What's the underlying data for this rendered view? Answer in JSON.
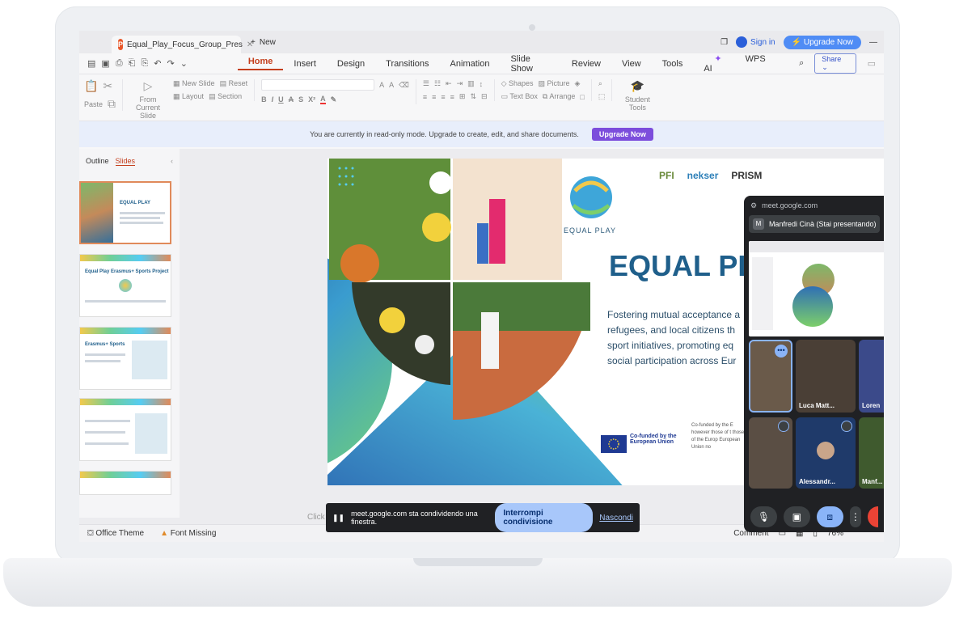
{
  "window": {
    "tab_title": "Equal_Play_Focus_Group_Pres",
    "new_tab": "New",
    "sign_in": "Sign in",
    "upgrade_now": "Upgrade Now"
  },
  "menu": {
    "items": [
      "Home",
      "Insert",
      "Design",
      "Transitions",
      "Animation",
      "Slide Show",
      "Review",
      "View",
      "Tools"
    ],
    "wps_ai": "WPS AI",
    "share": "Share"
  },
  "ribbon": {
    "paste": "Paste",
    "from_current_slide": "From Current Slide",
    "new_slide": "New Slide",
    "layout": "Layout",
    "reset": "Reset",
    "section": "Section",
    "shapes": "Shapes",
    "picture": "Picture",
    "text_box": "Text Box",
    "arrange": "Arrange",
    "student_tools": "Student Tools"
  },
  "banner": {
    "text": "You are currently in read-only mode. Upgrade to create, edit, and share documents.",
    "button": "Upgrade Now"
  },
  "left_panel": {
    "tab_outline": "Outline",
    "tab_slides": "Slides",
    "thumb1_title": "EQUAL PLAY",
    "thumb2_title": "Equal Play Erasmus+ Sports Project",
    "thumb3_title": "Erasmus+ Sports"
  },
  "slide": {
    "logo_caption": "EQUAL PLAY",
    "title": "EQUAL PL",
    "body": "Fostering mutual acceptance a refugees, and local citizens th sport initiatives, promoting eq social participation across Eur",
    "eu_label": "Co-funded by the European Union",
    "eu_disclaimer": "Co-funded by the E however those of t those of the Europ European Union no",
    "partner_logos": [
      "PFI",
      "nekser",
      "PRISM"
    ]
  },
  "notes_placeholder": "Click to add notes",
  "status": {
    "theme": "Office Theme",
    "font_missing": "Font Missing",
    "comment": "Comment",
    "zoom": "76%"
  },
  "sharebar": {
    "message": "meet.google.com sta condividendo una finestra.",
    "stop": "Interrompi condivisione",
    "hide": "Nascondi"
  },
  "meet": {
    "url": "meet.google.com",
    "presenter_badge": "M",
    "presenter": "Manfredi Cinà (Stai presentando)",
    "participants": [
      "Luca Matt...",
      "Loren",
      "Alessandr...",
      "Manf..."
    ]
  },
  "colors": {
    "accent": "#c43e1c",
    "banner_button": "#7c4ddc",
    "upgrade": "#4f8cf5",
    "slide_title": "#1f5f8b",
    "meet_bg": "#202124"
  }
}
